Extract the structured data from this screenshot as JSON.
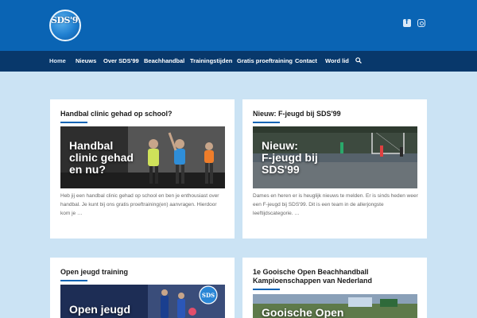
{
  "brand": {
    "logo_text": "SDS'99"
  },
  "social": {
    "facebook_icon": "facebook-icon",
    "instagram_icon": "instagram-icon"
  },
  "nav": {
    "items": [
      {
        "label": "Home",
        "active": true
      },
      {
        "label": "Nieuws"
      },
      {
        "label": "Over SDS'99"
      },
      {
        "label": "Beachhandbal"
      },
      {
        "label": "Trainingstijden"
      },
      {
        "label": "Gratis proeftraining"
      },
      {
        "label": "Contact"
      },
      {
        "label": "Word lid"
      }
    ],
    "search_icon": "search-icon"
  },
  "posts": [
    {
      "title": "Handbal clinic gehad op school?",
      "image_text": "Handbal\nclinic gehad\nen nu?",
      "excerpt": "Heb jij een handbal clinic gehad op school en ben je enthousiast over handbal. Je kunt bij ons gratis proeftraining(en) aanvragen. Hierdoor kom je …"
    },
    {
      "title": "Nieuw: F-jeugd bij SDS'99",
      "image_text": "Nieuw:\nF-jeugd bij\nSDS'99",
      "excerpt": "Dames en heren er is heuglijk nieuws te melden. Er is sinds heden weer een F-jeugd bij SDS'99. Dit is een team in de allerjongste leeftijdscategorie. …"
    },
    {
      "title": "Open jeugd training",
      "image_text": "Open jeugd",
      "excerpt": ""
    },
    {
      "title": "1e Gooische Open Beachhandball Kampioenschappen van Nederland",
      "image_text": "Gooische Open",
      "excerpt": ""
    }
  ],
  "colors": {
    "top_bar": "#0a64b4",
    "nav_bar": "#08386b",
    "page_bg": "#cbe3f4",
    "accent": "#0a64b4"
  }
}
